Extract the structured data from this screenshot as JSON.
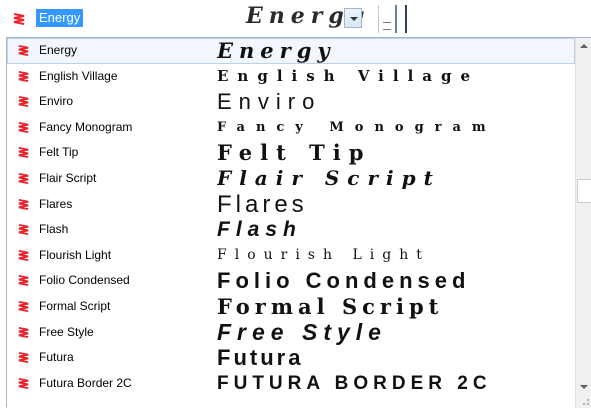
{
  "combo": {
    "selected_name": "Energy",
    "selected_preview": "Energy",
    "icon": "font-stroke-icon"
  },
  "fonts": [
    {
      "name": "Energy",
      "preview": "Energy",
      "selected": true
    },
    {
      "name": "English Village",
      "preview": "English Village"
    },
    {
      "name": "Enviro",
      "preview": "Enviro"
    },
    {
      "name": "Fancy Monogram",
      "preview": "Fancy Monogram"
    },
    {
      "name": "Felt Tip",
      "preview": "Felt Tip"
    },
    {
      "name": "Flair Script",
      "preview": "Flair Script"
    },
    {
      "name": "Flares",
      "preview": "Flares"
    },
    {
      "name": "Flash",
      "preview": "Flash"
    },
    {
      "name": "Flourish Light",
      "preview": "Flourish Light"
    },
    {
      "name": "Folio Condensed",
      "preview": "Folio Condensed"
    },
    {
      "name": "Formal Script",
      "preview": "Formal Script"
    },
    {
      "name": "Free Style",
      "preview": "Free Style"
    },
    {
      "name": "Futura",
      "preview": "Futura"
    },
    {
      "name": "Futura Border 2C",
      "preview": "FUTURA BORDER 2C"
    }
  ],
  "colors": {
    "selection": "#3399ff",
    "icon_red": "#e8252b",
    "row_highlight": "#f3f7fd"
  }
}
